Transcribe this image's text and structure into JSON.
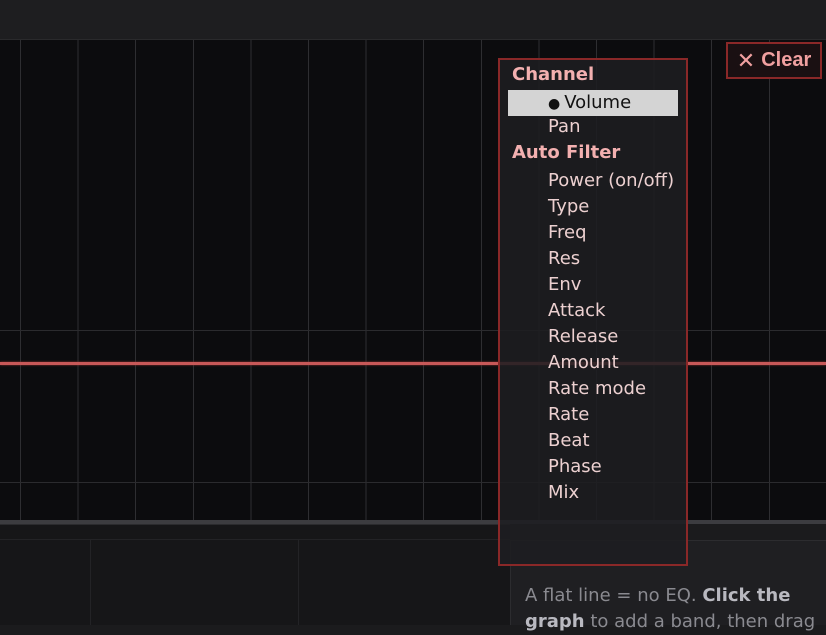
{
  "clear_button": {
    "icon": "close-icon",
    "label": "Clear"
  },
  "menu": {
    "groups": [
      {
        "label": "Channel",
        "items": [
          "Volume",
          "Pan"
        ],
        "selected": "Volume"
      },
      {
        "label": "Auto Filter",
        "items": [
          "Power (on/off)",
          "Type",
          "Freq",
          "Res",
          "Env",
          "Attack",
          "Release",
          "Amount",
          "Rate mode",
          "Rate",
          "Beat",
          "Phase",
          "Mix"
        ]
      }
    ],
    "selected_marker": "●"
  },
  "help": {
    "text_1": "A flat line = no EQ. ",
    "bold": "Click the graph",
    "text_2": " to add a band, then drag"
  },
  "colors": {
    "accent": "#c85858",
    "border": "#8a2828",
    "group_text": "#f3b0b0"
  }
}
